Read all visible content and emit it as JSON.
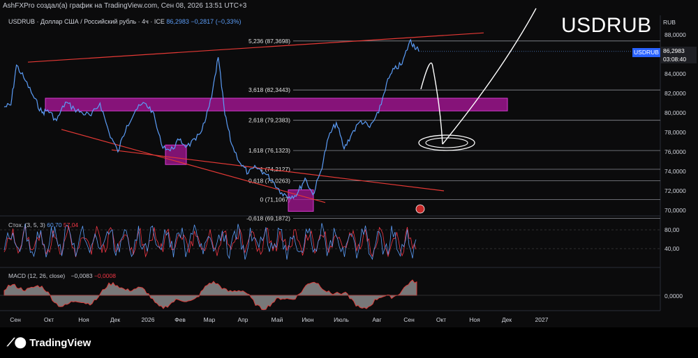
{
  "header": {
    "attribution": "AshFXPro создал(а) график на TradingView.com, Сен 08, 2026 13:51 UTC+3"
  },
  "legend": {
    "symbol": "USDRUB · Доллар США / Российский рубль · 4ч · ICE",
    "price": "86,2983",
    "change": "−0,2817 (−0,33%)"
  },
  "price_badge": {
    "symbol": "USDRUB",
    "price": "86,2983",
    "countdown": "03:08:40",
    "currency": "RUB"
  },
  "overlay_title": "USDRUB",
  "fib_levels": [
    {
      "label": "5,236 (87,3698)",
      "value": 87.3698
    },
    {
      "label": "3,618 (82,3443)",
      "value": 82.3443
    },
    {
      "label": "2,618 (79,2383)",
      "value": 79.2383
    },
    {
      "label": "1,618 (76,1323)",
      "value": 76.1323
    },
    {
      "label": "1 (74,2127)",
      "value": 74.2127
    },
    {
      "label": "0,618 (73,0263)",
      "value": 73.0263
    },
    {
      "label": "0 (71,1067)",
      "value": 71.1067
    },
    {
      "label": "-0,618 (69,1872)",
      "value": 69.1872
    }
  ],
  "price_axis_labels": [
    "88,0000",
    "86,0000",
    "84,0000",
    "82,0000",
    "80,0000",
    "78,0000",
    "76,0000",
    "74,0000",
    "72,0000",
    "70,0000"
  ],
  "stoch": {
    "label": "Стох. (3, 5, 3)",
    "k": "60,70",
    "d": "57,04",
    "axis_labels": [
      "80,00",
      "40,00"
    ]
  },
  "macd": {
    "label": "MACD (12, 26, close)",
    "value1": "−0,0083",
    "value2": "−0,0008",
    "axis_label": "0,0000"
  },
  "time_axis": [
    "Сен",
    "Окт",
    "Ноя",
    "Дек",
    "2026",
    "Фев",
    "Мар",
    "Апр",
    "Май",
    "Июн",
    "Июль",
    "Авг",
    "Сен",
    "Окт",
    "Ноя",
    "Дек",
    "2027"
  ],
  "footer": {
    "brand": "TradingView"
  },
  "colors": {
    "price_line": "#5b9cf6",
    "trendline": "#e53935",
    "zone": "#b0179e",
    "stoch_k": "#5b9cf6",
    "stoch_d": "#f23645",
    "macd_fill": "#9e9e9e"
  },
  "chart_data": {
    "type": "line",
    "title": "USDRUB · Доллар США / Российский рубль · 4ч · ICE",
    "ylim": [
      69.0,
      88.8
    ],
    "x_range": [
      "2025-09",
      "2027-01"
    ],
    "series": [
      {
        "name": "USDRUB",
        "x": [
          "2025-09-01",
          "2025-09-07",
          "2025-09-12",
          "2025-09-20",
          "2025-09-28",
          "2025-10-05",
          "2025-10-10",
          "2025-10-18",
          "2025-10-26",
          "2025-11-03",
          "2025-11-10",
          "2025-11-18",
          "2025-11-26",
          "2025-12-04",
          "2025-12-12",
          "2025-12-20",
          "2025-12-28",
          "2026-01-05",
          "2026-01-12",
          "2026-01-20",
          "2026-01-28",
          "2026-02-05",
          "2026-02-12",
          "2026-02-20",
          "2026-02-28",
          "2026-03-06",
          "2026-03-12",
          "2026-03-18",
          "2026-03-24",
          "2026-04-01",
          "2026-04-08",
          "2026-04-15",
          "2026-04-22",
          "2026-04-30",
          "2026-05-08",
          "2026-05-15",
          "2026-05-22",
          "2026-05-29",
          "2026-06-05",
          "2026-06-12",
          "2026-06-19",
          "2026-06-26",
          "2026-07-03",
          "2026-07-10",
          "2026-07-18",
          "2026-07-26",
          "2026-08-03",
          "2026-08-10",
          "2026-08-17",
          "2026-08-24",
          "2026-08-31",
          "2026-09-04",
          "2026-09-08"
        ],
        "values": [
          80.6,
          80.8,
          84.9,
          83.3,
          81.5,
          80.0,
          80.3,
          79.2,
          81.1,
          80.4,
          80.0,
          79.7,
          81.0,
          78.0,
          76.0,
          78.7,
          80.3,
          81.0,
          80.2,
          76.8,
          76.1,
          77.2,
          76.6,
          77.2,
          79.0,
          81.5,
          85.7,
          79.8,
          76.8,
          74.8,
          73.8,
          74.4,
          73.9,
          73.0,
          71.8,
          71.4,
          71.7,
          73.3,
          71.6,
          74.0,
          77.5,
          79.0,
          76.3,
          77.9,
          79.2,
          78.5,
          80.0,
          83.0,
          84.5,
          85.0,
          87.4,
          86.9,
          86.3
        ]
      }
    ],
    "xlabel": "",
    "ylabel": "",
    "grid": false,
    "legend": "top-left"
  }
}
